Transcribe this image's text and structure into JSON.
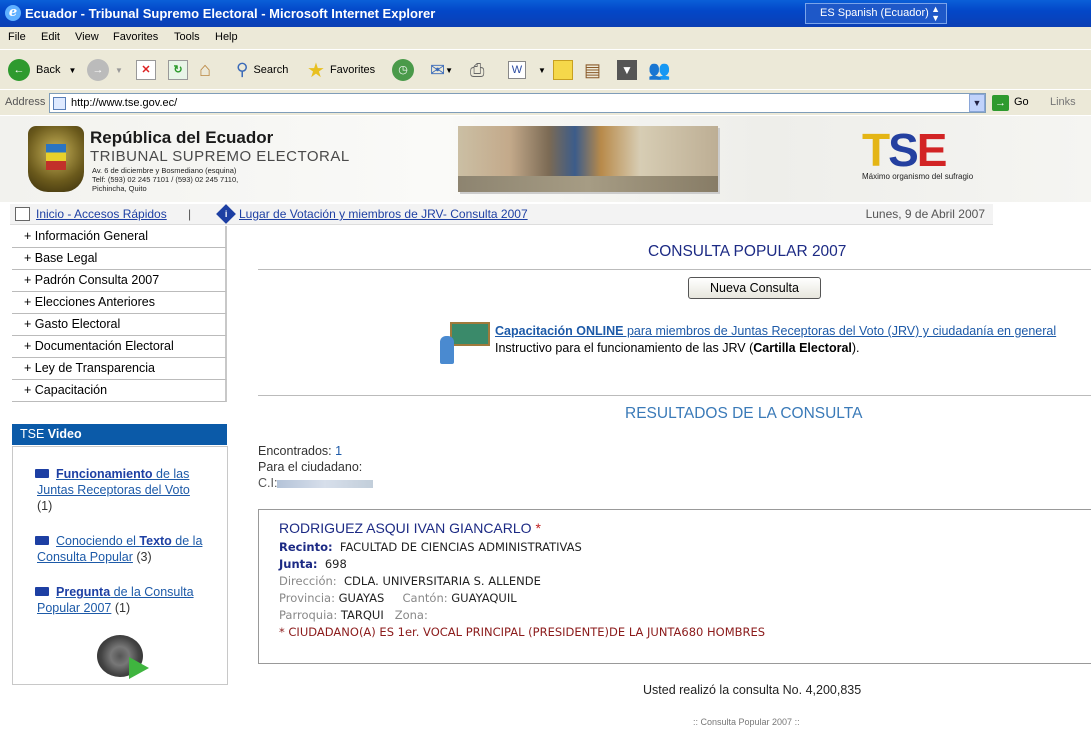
{
  "window": {
    "title": "Ecuador - Tribunal Supremo Electoral - Microsoft Internet Explorer",
    "language": "ES Spanish (Ecuador)"
  },
  "menu": [
    "File",
    "Edit",
    "View",
    "Favorites",
    "Tools",
    "Help"
  ],
  "toolbar": {
    "back": "Back",
    "search": "Search",
    "favorites": "Favorites"
  },
  "address": {
    "label": "Address",
    "url": "http://www.tse.gov.ec/",
    "go": "Go",
    "links": "Links"
  },
  "header": {
    "republic": "República del Ecuador",
    "tribunal": "TRIBUNAL SUPREMO ELECTORAL",
    "address_lines": "Av. 6 de diciembre y Bosmediano (esquina)\nTelf: (593) 02 245 7101 / (593) 02 245 7110,\nPichincha, Quito",
    "logo": "TSE",
    "tagline": "Máximo organismo del sufragio"
  },
  "nav": {
    "home_link": "Inicio - Accesos Rápidos",
    "separator": "|",
    "vote_link": "Lugar de Votación y miembros de JRV- Consulta 2007",
    "date": "Lunes, 9 de Abril 2007"
  },
  "sidebar": {
    "items": [
      "+ Información General",
      "+ Base Legal",
      "+ Padrón Consulta 2007",
      "+ Elecciones Anteriores",
      "+ Gasto Electoral",
      "+ Documentación Electoral",
      "+ Ley de Transparencia",
      "+ Capacitación"
    ],
    "video_header_prefix": "TSE",
    "video_header_bold": "Video",
    "videos": [
      {
        "bold": "Funcionamiento",
        "rest1": " de las",
        "rest2": "Juntas Receptoras del Voto",
        "count": "(1)"
      },
      {
        "pre": "Conociendo el ",
        "bold": "Texto",
        "rest1": " de la",
        "rest2": "Consulta Popular",
        "count": "(3)"
      },
      {
        "bold": "Pregunta",
        "rest1": " de la Consulta",
        "rest2": "Popular 2007",
        "count": "(1)"
      }
    ]
  },
  "main": {
    "title": "CONSULTA POPULAR 2007",
    "new_query_button": "Nueva Consulta",
    "training_link_bold": "Capacitación ONLINE",
    "training_link_rest": " para miembros de Juntas Receptoras del Voto (JRV) y ciudadanía en general",
    "instructivo_pre": "Instructivo para el funcionamiento de las JRV (",
    "instructivo_bold": "Cartilla Electoral",
    "instructivo_post": ").",
    "results_title": "RESULTADOS DE LA CONSULTA",
    "found_label": "Encontrados:",
    "found_count": "1",
    "for_citizen": "Para el ciudadano:",
    "ci_label": "C.I:",
    "result": {
      "name": "RODRIGUEZ ASQUI IVAN GIANCARLO",
      "star": "*",
      "recinto_label": "Recinto:",
      "recinto": "FACULTAD DE CIENCIAS ADMINISTRATIVAS",
      "junta_label": "Junta:",
      "junta": "698",
      "direccion_label": "Dirección:",
      "direccion": "CDLA. UNIVERSITARIA S. ALLENDE",
      "provincia_label": "Provincia:",
      "provincia": "GUAYAS",
      "canton_label": "Cantón:",
      "canton": "GUAYAQUIL",
      "parroquia_label": "Parroquia:",
      "parroquia": "TARQUI",
      "zona_label": "Zona:",
      "note": "* CIUDADANO(A) ES 1er. VOCAL PRINCIPAL (PRESIDENTE)DE LA JUNTA680 HOMBRES"
    },
    "query_number": "Usted realizó la consulta No. 4,200,835",
    "footer": ":: Consulta Popular 2007 ::"
  }
}
